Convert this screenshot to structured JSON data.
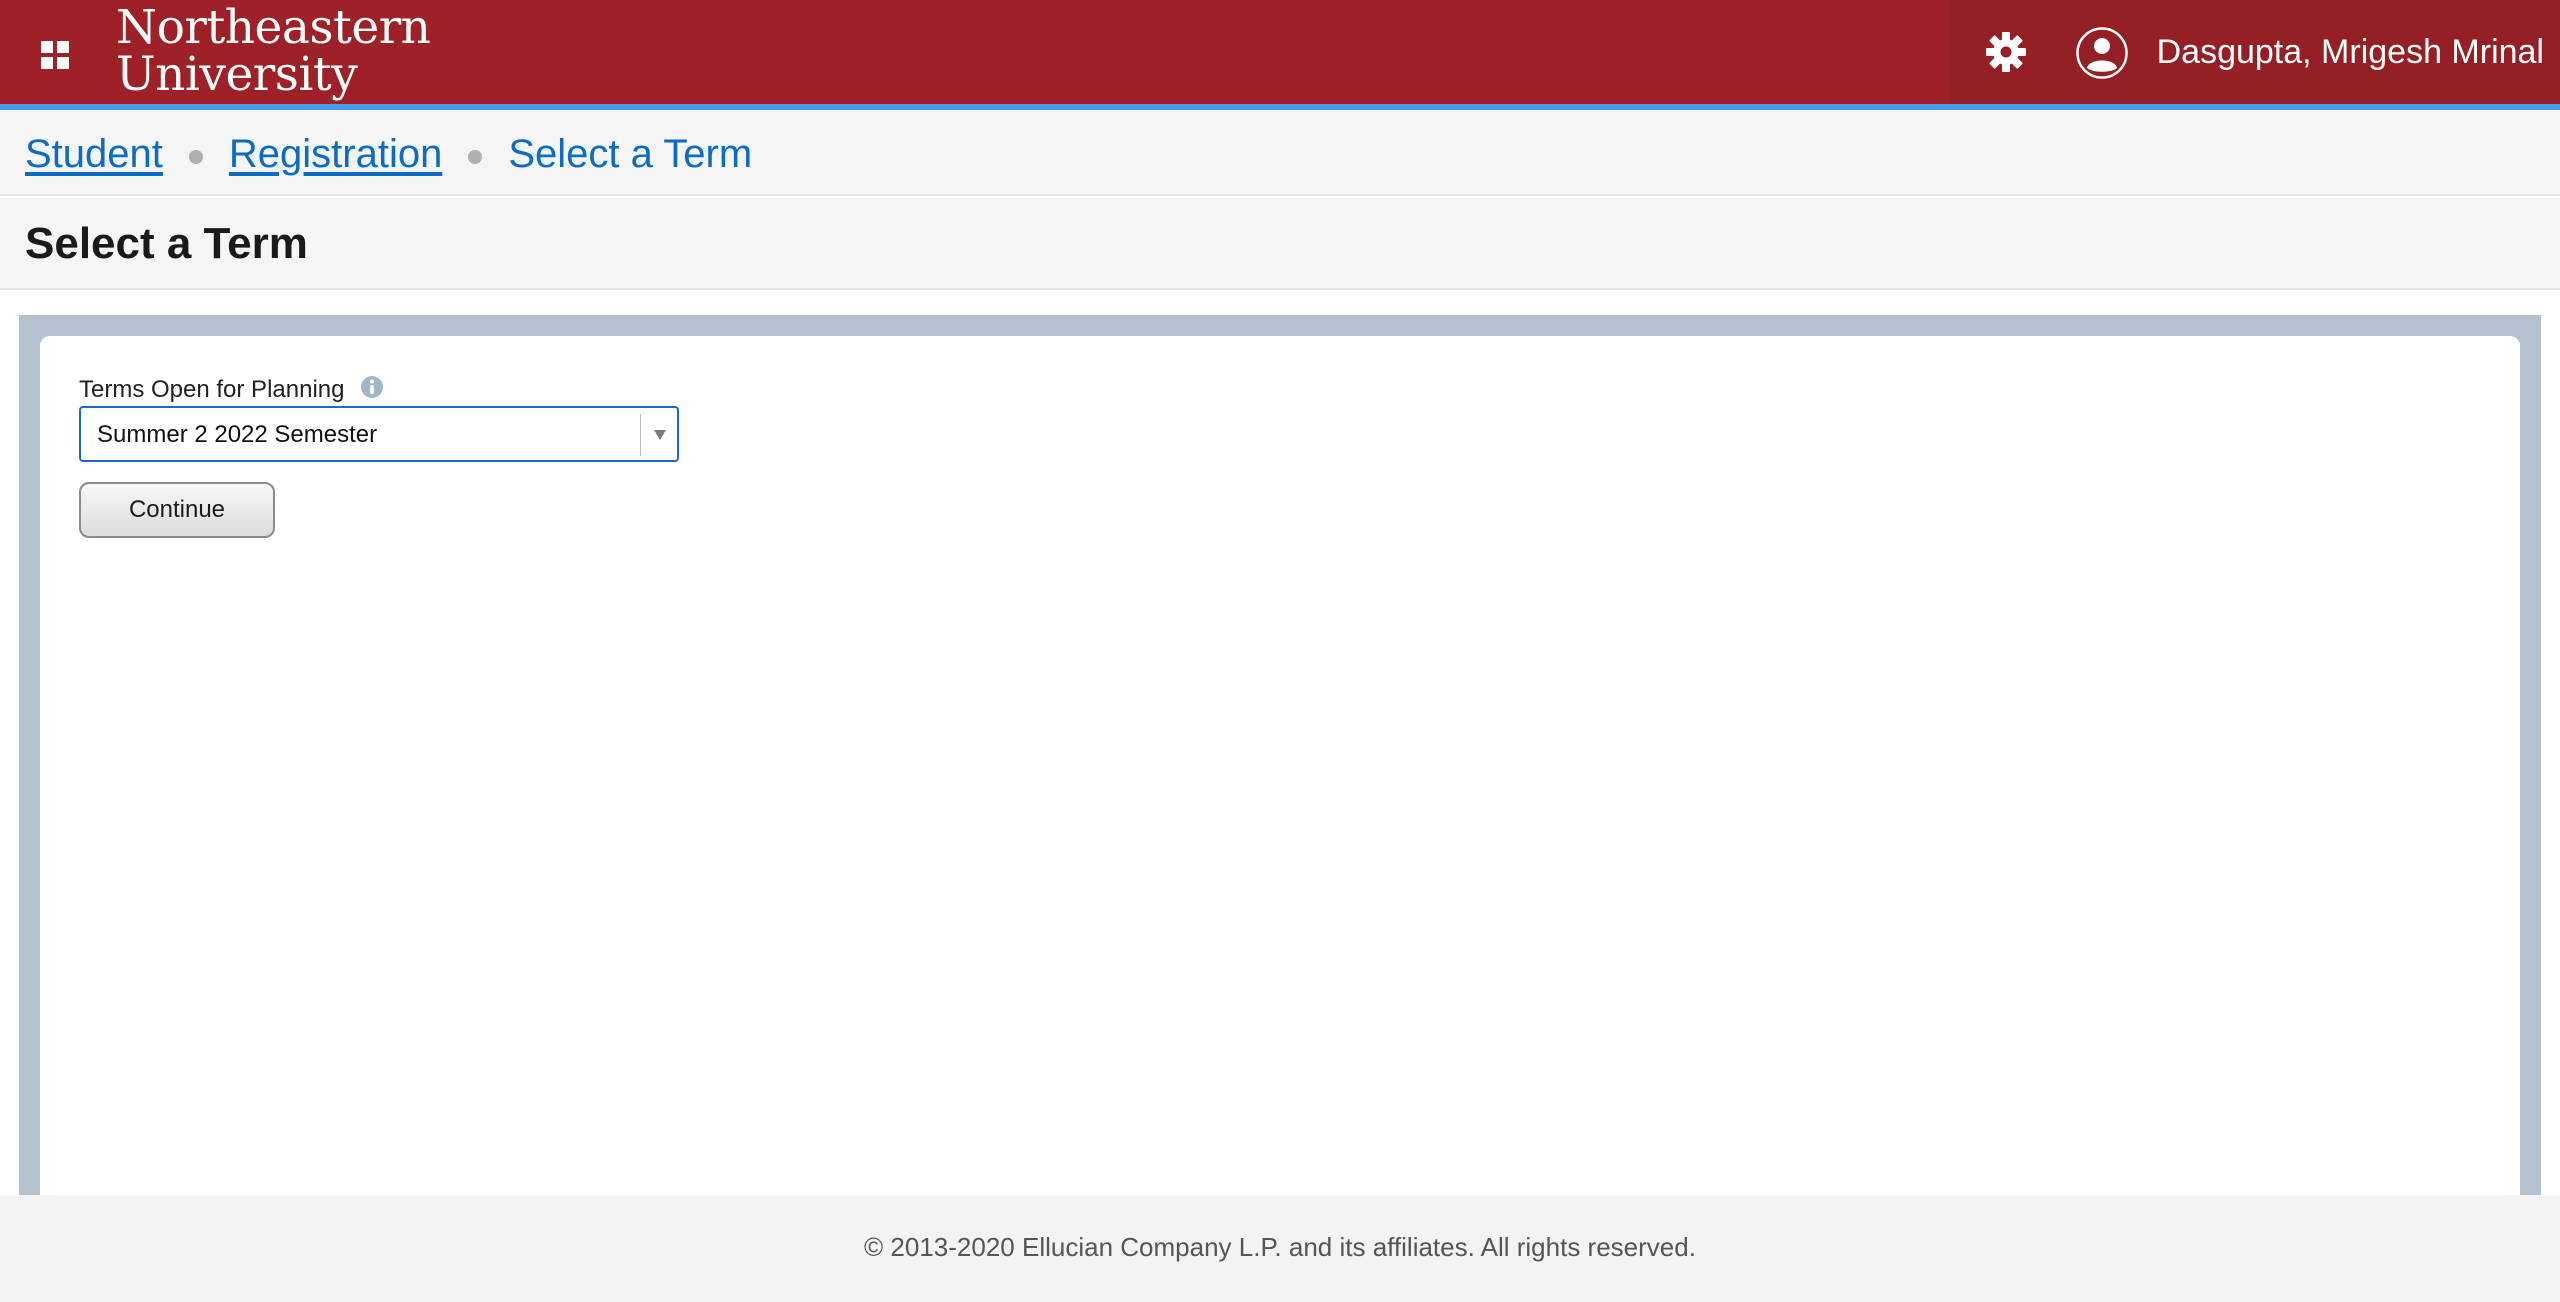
{
  "header": {
    "logo_line1": "Northeastern",
    "logo_line2": "University",
    "user_name": "Dasgupta, Mrigesh Mrinal",
    "icons": [
      "apps-grid-icon",
      "gear-icon",
      "user-avatar-icon"
    ]
  },
  "breadcrumb": {
    "items": [
      {
        "label": "Student"
      },
      {
        "label": "Registration"
      }
    ],
    "current": "Select a Term"
  },
  "page": {
    "title": "Select a Term"
  },
  "term_form": {
    "label": "Terms Open for Planning",
    "selected_term": "Summer 2 2022 Semester",
    "continue_label": "Continue"
  },
  "footer": {
    "copyright": "© 2013-2020 Ellucian Company L.P. and its affiliates. All rights reserved."
  },
  "colors": {
    "header_bg": "#9d2127",
    "header_accent": "#4b9bea",
    "link": "#0a6cc4",
    "panel_frame": "#b3c0cf"
  }
}
